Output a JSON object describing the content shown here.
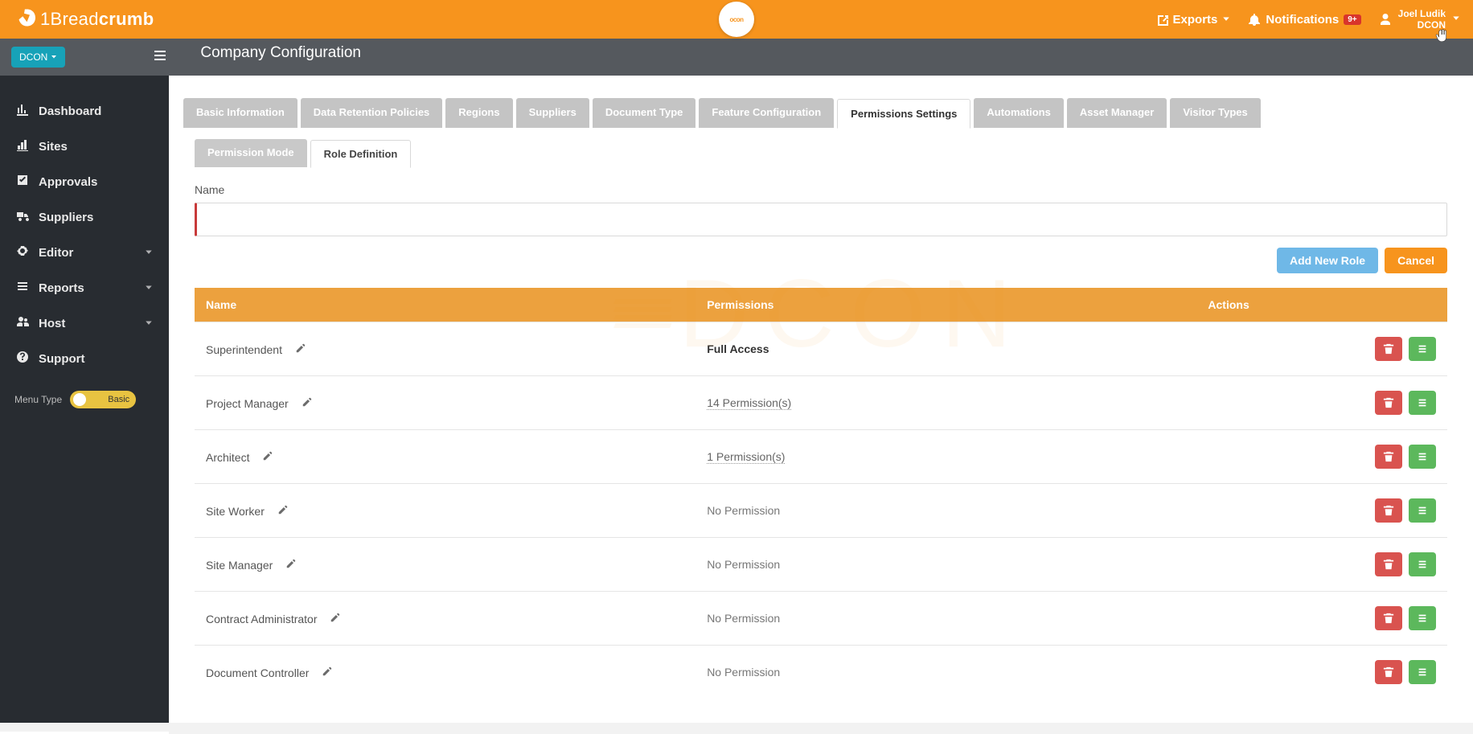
{
  "brand": {
    "prefix": "1Bread",
    "suffix": "crumb"
  },
  "center_badge": "ocon",
  "header": {
    "exports": "Exports",
    "notifications": "Notifications",
    "notif_count": "9+",
    "user_name": "Joel Ludik",
    "user_org": "DCON"
  },
  "org_chip": "DCON",
  "page_title": "Company Configuration",
  "sidebar": {
    "items": [
      {
        "label": "Dashboard",
        "icon": "chart",
        "expandable": false
      },
      {
        "label": "Sites",
        "icon": "site",
        "expandable": false
      },
      {
        "label": "Approvals",
        "icon": "check",
        "expandable": false
      },
      {
        "label": "Suppliers",
        "icon": "truck",
        "expandable": false
      },
      {
        "label": "Editor",
        "icon": "gear",
        "expandable": true
      },
      {
        "label": "Reports",
        "icon": "list",
        "expandable": true
      },
      {
        "label": "Host",
        "icon": "host",
        "expandable": true
      },
      {
        "label": "Support",
        "icon": "help",
        "expandable": false
      }
    ],
    "menu_type_label": "Menu Type",
    "menu_type_value": "Basic"
  },
  "tabs": [
    "Basic Information",
    "Data Retention Policies",
    "Regions",
    "Suppliers",
    "Document Type",
    "Feature Configuration",
    "Permissions Settings",
    "Automations",
    "Asset Manager",
    "Visitor Types"
  ],
  "active_tab_index": 6,
  "subtabs": [
    "Permission Mode",
    "Role Definition"
  ],
  "active_subtab_index": 1,
  "form": {
    "name_label": "Name",
    "name_value": "",
    "add_label": "Add New Role",
    "cancel_label": "Cancel"
  },
  "table": {
    "columns": [
      "Name",
      "Permissions",
      "Actions"
    ],
    "rows": [
      {
        "name": "Superintendent",
        "perm_text": "Full Access",
        "perm_style": "full"
      },
      {
        "name": "Project Manager",
        "perm_text": "14 Permission(s)",
        "perm_style": "link"
      },
      {
        "name": "Architect",
        "perm_text": "1 Permission(s)",
        "perm_style": "link"
      },
      {
        "name": "Site Worker",
        "perm_text": "No Permission",
        "perm_style": "none"
      },
      {
        "name": "Site Manager",
        "perm_text": "No Permission",
        "perm_style": "none"
      },
      {
        "name": "Contract Administrator",
        "perm_text": "No Permission",
        "perm_style": "none"
      },
      {
        "name": "Document Controller",
        "perm_text": "No Permission",
        "perm_style": "none"
      }
    ]
  }
}
